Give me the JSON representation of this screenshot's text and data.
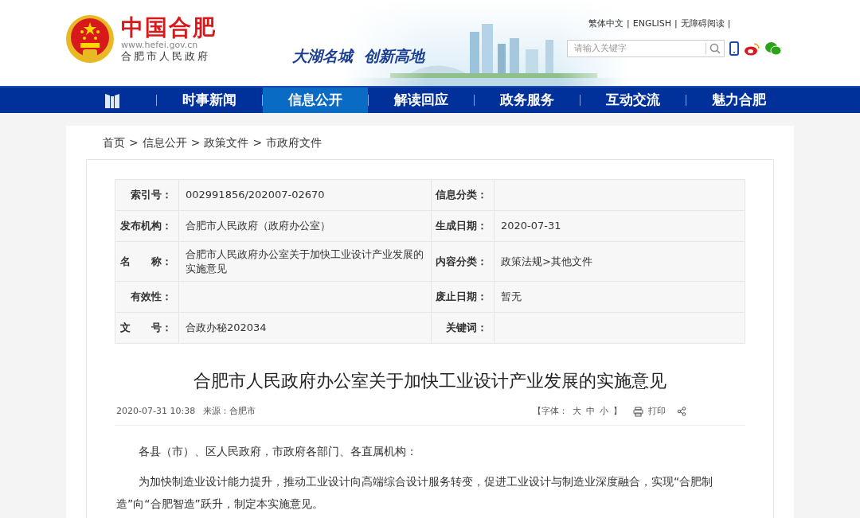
{
  "header": {
    "site_name": "中国合肥",
    "url": "www.hefei.gov.cn",
    "org": "合肥市人民政府",
    "slogan": [
      "大湖名城",
      "创新高地"
    ],
    "top_links": [
      "繁体中文",
      "ENGLISH",
      "无障碍阅读"
    ],
    "link_separator": "|",
    "search": {
      "placeholder": "请输入关键字"
    }
  },
  "nav": {
    "items": [
      {
        "label": "时事新闻",
        "selected": false
      },
      {
        "label": "信息公开",
        "selected": true
      },
      {
        "label": "解读回应",
        "selected": false
      },
      {
        "label": "政务服务",
        "selected": false
      },
      {
        "label": "互动交流",
        "selected": false
      },
      {
        "label": "魅力合肥",
        "selected": false
      }
    ]
  },
  "breadcrumb": {
    "items": [
      "首页",
      "信息公开",
      "政策文件",
      "市政府文件"
    ],
    "separator": ">"
  },
  "info_table": {
    "rows": [
      [
        {
          "label": "索引号：",
          "value": "002991856/202007-02670"
        },
        {
          "label": "信息分类："
        }
      ],
      [
        {
          "label": "发布机构：",
          "value": "合肥市人民政府（政府办公室）"
        },
        {
          "label": "生成日期：",
          "value": "2020-07-31"
        }
      ],
      [
        {
          "label": "名　　称：",
          "value": "合肥市人民政府办公室关于加快工业设计产业发展的实施意见"
        },
        {
          "label": "内容分类：",
          "value": "政策法规>其他文件"
        }
      ],
      [
        {
          "label": "有效性："
        },
        {
          "label": "废止日期：",
          "value": "暂无"
        }
      ],
      [
        {
          "label": "文　　号：",
          "value": "合政办秘202034"
        },
        {
          "label": "关键词："
        }
      ]
    ]
  },
  "article": {
    "title": "合肥市人民政府办公室关于加快工业设计产业发展的实施意见",
    "date": "2020-07-31 10:38",
    "source": "来源：合肥市",
    "font_open": "【字体：",
    "font_sizes": [
      "大",
      "中",
      "小"
    ],
    "font_close": "】",
    "print": "打印",
    "paragraphs": [
      "各县（市）、区人民政府，市政府各部门、各直属机构：",
      "为加快制造业设计能力提升，推动工业设计向高端综合设计服务转变，促进工业设计与制造业深度融合，实现“合肥制造”向“合肥智造”跃升，制定本实施意见。"
    ]
  }
}
